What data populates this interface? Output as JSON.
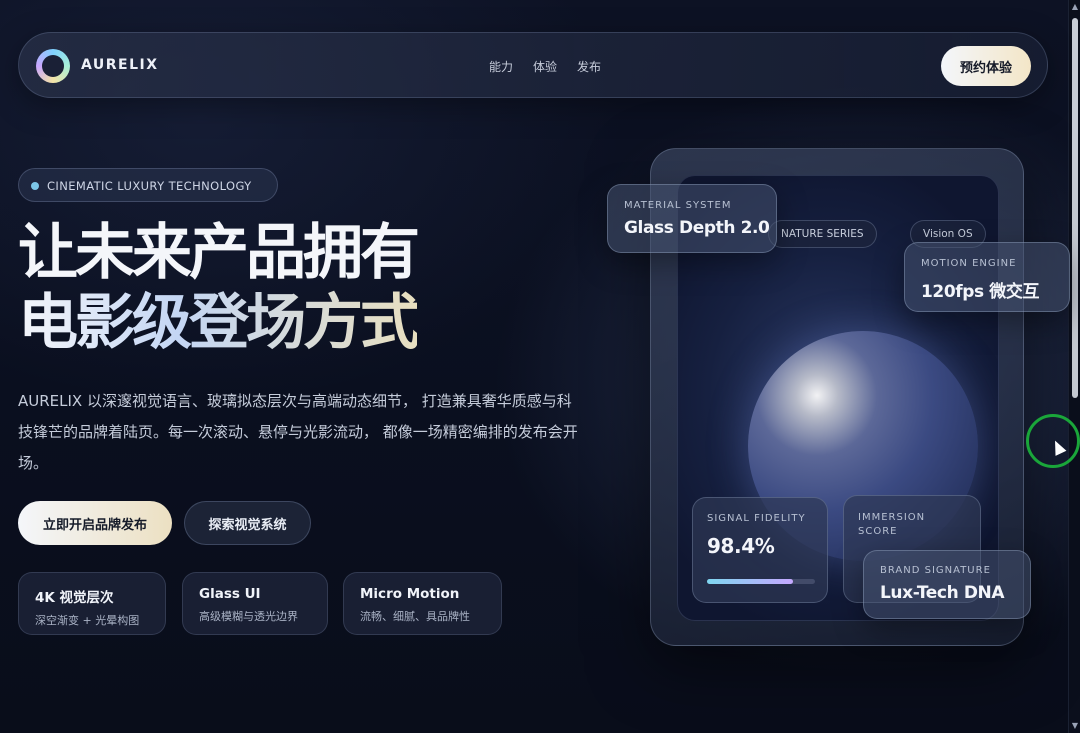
{
  "nav": {
    "brand": "AURELIX",
    "links": [
      "能力",
      "体验",
      "发布"
    ],
    "cta": "预约体验"
  },
  "hero": {
    "tag": "CINEMATIC LUXURY TECHNOLOGY",
    "headline_line1": "让未来产品拥有",
    "headline_line2": "电影级登场方式",
    "description": "AURELIX 以深邃视觉语言、玻璃拟态层次与高端动态细节， 打造兼具奢华质感与科技锋芒的品牌着陆页。每一次滚动、悬停与光影流动， 都像一场精密编排的发布会开场。",
    "primary_button": "立即开启品牌发布",
    "secondary_button": "探索视觉系统",
    "features": [
      {
        "title": "4K 视觉层次",
        "subtitle": "深空渐变 + 光晕构图"
      },
      {
        "title": "Glass UI",
        "subtitle": "高级模糊与透光边界"
      },
      {
        "title": "Micro Motion",
        "subtitle": "流畅、细腻、具品牌性"
      }
    ]
  },
  "showcase": {
    "chips": [
      "NATURE SERIES",
      "Vision OS"
    ],
    "material": {
      "label": "MATERIAL SYSTEM",
      "value": "Glass Depth 2.0"
    },
    "motion": {
      "label": "MOTION ENGINE",
      "value": "120fps 微交互"
    },
    "signal": {
      "label": "SIGNAL FIDELITY",
      "value": "98.4%",
      "progress": 0.8
    },
    "immersion": {
      "label_line1": "IMMERSION",
      "label_line2": "SCORE"
    },
    "brand_signature": {
      "label": "BRAND SIGNATURE",
      "value": "Lux-Tech DNA"
    }
  }
}
